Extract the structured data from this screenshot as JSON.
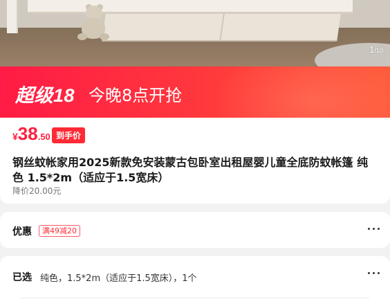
{
  "gallery": {
    "counter_current": "1",
    "counter_total": "/10"
  },
  "promo": {
    "brand": "超级18",
    "slogan": "今晚8点开抢",
    "colors": {
      "start": "#ff1b45",
      "end": "#ff5a3a"
    }
  },
  "price": {
    "currency": "¥",
    "integer": "38",
    "decimal": ".50",
    "badge": "到手价",
    "color": "#ff1f3f"
  },
  "product": {
    "title": "钢丝蚊帐家用2025新款免安装蒙古包卧室出租屋婴儿童全底防蚊帐篷 纯色 1.5*2m（适应于1.5宽床）",
    "original_price": "降价20.00元"
  },
  "coupon": {
    "label": "优惠",
    "tag": "满49减20",
    "more_icon": "more-dots-icon"
  },
  "selection": {
    "label": "已选",
    "value": "纯色，1.5*2m（适应于1.5宽床），1个",
    "more_icon": "more-dots-icon"
  }
}
